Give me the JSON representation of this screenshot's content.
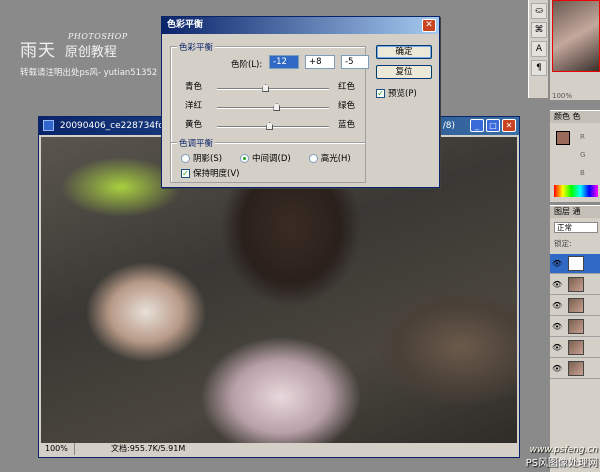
{
  "watermark": {
    "brand": "雨天",
    "photoshop": "PHOTOSHOP",
    "brand2": "原创教程",
    "notice": "转载请注明出处ps风- yutian51352"
  },
  "doc_window": {
    "title": "20090406_ce228734fce",
    "title_suffix": "/8)",
    "status_zoom": "100%",
    "status_doc": "文档:955.7K/5.91M"
  },
  "dialog": {
    "title": "色彩平衡",
    "close_label": "✕",
    "color_balance_group": "色彩平衡",
    "levels_label": "色阶(L):",
    "levels": [
      "-12",
      "+8",
      "-5"
    ],
    "sliders": [
      {
        "left": "青色",
        "right": "红色",
        "value": -12
      },
      {
        "left": "洋红",
        "right": "绿色",
        "value": 8
      },
      {
        "left": "黄色",
        "right": "蓝色",
        "value": -5
      }
    ],
    "tone_group": "色调平衡",
    "tones": [
      "阴影(S)",
      "中间调(D)",
      "高光(H)"
    ],
    "selected_tone": "中间调(D)",
    "preserve_luminosity": "保持明度(V)",
    "ok_label": "确定",
    "reset_label": "复位",
    "preview_label": "预览(P)"
  },
  "nav": {
    "zoom": "100%"
  },
  "color_panel": {
    "tab": "颜色",
    "tab2": "色",
    "channels": [
      "R",
      "G",
      "B"
    ],
    "swatch": "#9a6a5a"
  },
  "layers_panel": {
    "tab": "图层",
    "tab2": "通",
    "blend": "正常",
    "lock": "锁定:"
  },
  "site": {
    "url": "www.psfeng.cn",
    "name": "PS风图像处理网"
  }
}
